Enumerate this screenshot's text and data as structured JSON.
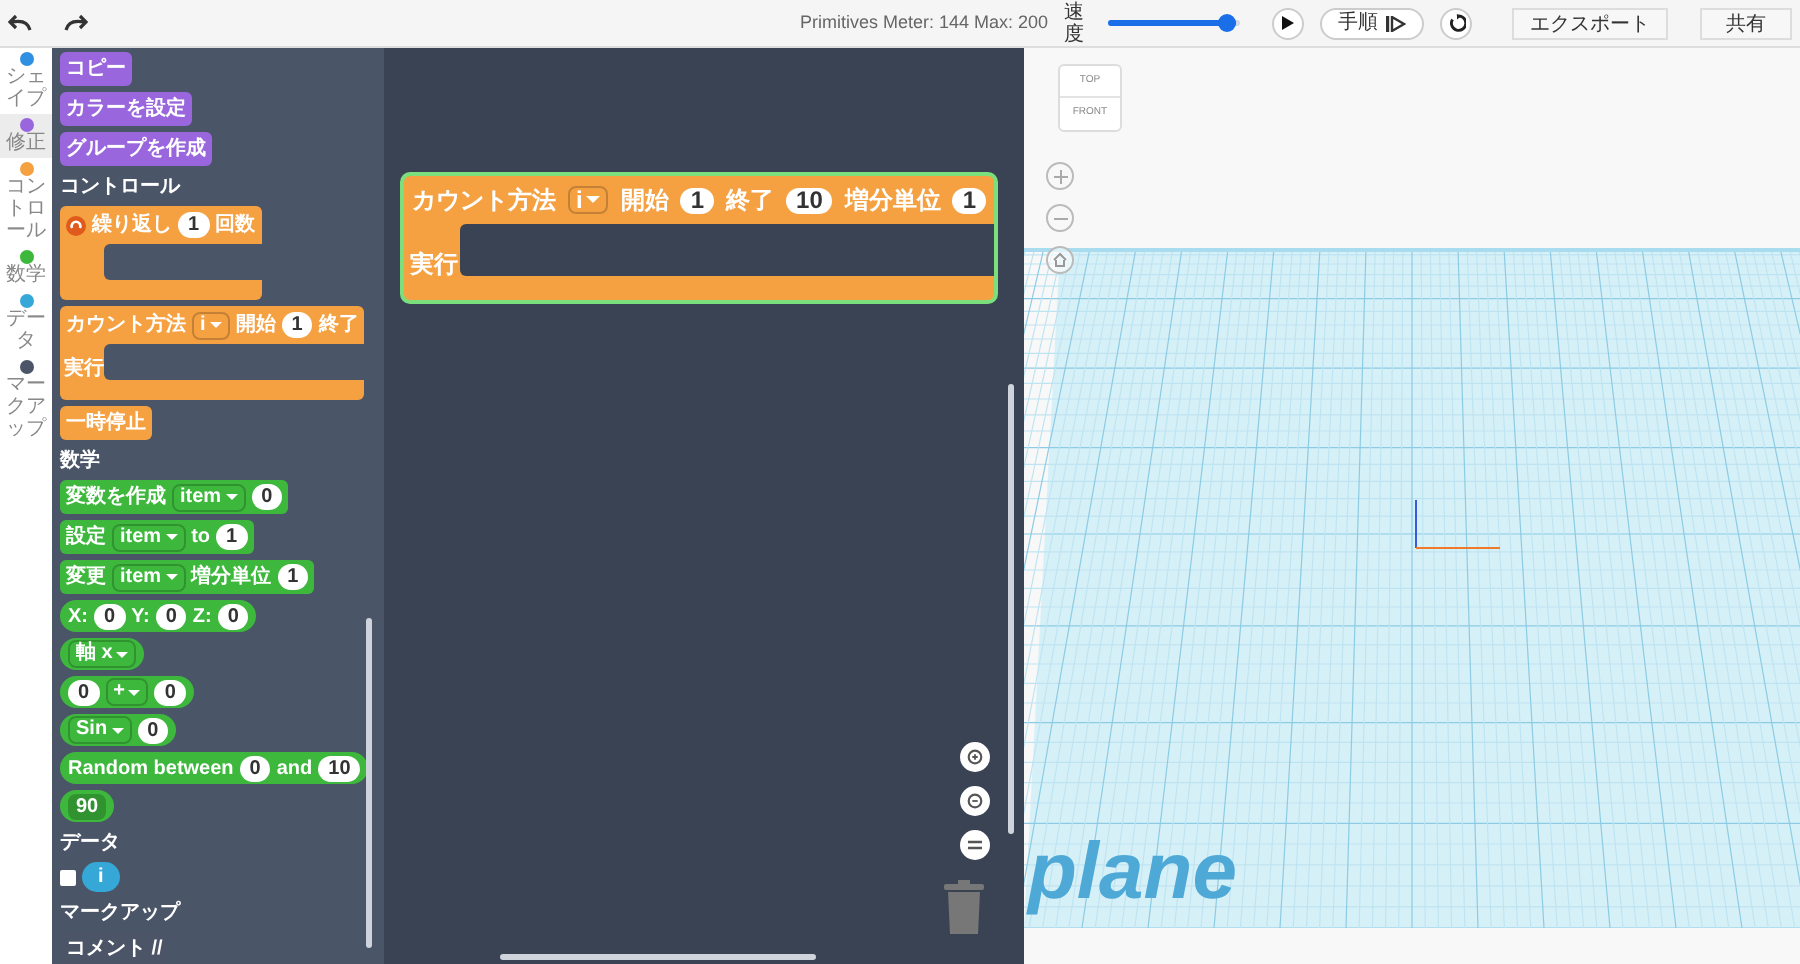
{
  "toolbar": {
    "meter": "Primitives Meter: 144 Max: 200",
    "speed_label": "速度",
    "speed": {
      "level": 0.97
    },
    "step_button": "手順",
    "export_button": "エクスポート",
    "share_button": "共有"
  },
  "categories": [
    {
      "label": "シェイプ",
      "color": "#2f8fe0",
      "selected": false
    },
    {
      "label": "修正",
      "color": "#9966dd",
      "selected": true
    },
    {
      "label": "コントロール",
      "color": "#f5a142",
      "selected": false
    },
    {
      "label": "数学",
      "color": "#3db83d",
      "selected": false
    },
    {
      "label": "データ",
      "color": "#35a8d8",
      "selected": false
    },
    {
      "label": "マークアップ",
      "color": "#4b5567",
      "selected": false
    }
  ],
  "flyout": [
    {
      "kind": "stack",
      "color": "#9966dd",
      "parts": [
        {
          "kind": "text",
          "text": "コピー"
        }
      ]
    },
    {
      "kind": "stack",
      "color": "#9966dd",
      "parts": [
        {
          "kind": "text",
          "text": "カラーを設定"
        }
      ]
    },
    {
      "kind": "stack",
      "color": "#9966dd",
      "parts": [
        {
          "kind": "text",
          "text": "グループを作成"
        }
      ]
    },
    {
      "kind": "heading",
      "text": "コントロール"
    },
    {
      "kind": "c_block",
      "color": "#f5a142",
      "has_icon": true,
      "parts": [
        {
          "kind": "text",
          "text": "繰り返し"
        },
        {
          "kind": "number",
          "text": "1"
        },
        {
          "kind": "text",
          "text": "回数"
        }
      ]
    },
    {
      "kind": "c_block",
      "color": "#f5a142",
      "has_icon": false,
      "inner_label": "実行",
      "parts": [
        {
          "kind": "text",
          "text": "カウント方法"
        },
        {
          "kind": "dropdown",
          "text": "i"
        },
        {
          "kind": "text",
          "text": "開始"
        },
        {
          "kind": "number",
          "text": "1"
        },
        {
          "kind": "text",
          "text": "終了"
        }
      ]
    },
    {
      "kind": "stack",
      "color": "#f5a142",
      "parts": [
        {
          "kind": "text",
          "text": "一時停止"
        }
      ]
    },
    {
      "kind": "heading",
      "text": "数学"
    },
    {
      "kind": "stack",
      "color": "#3db83d",
      "parts": [
        {
          "kind": "text",
          "text": "変数を作成"
        },
        {
          "kind": "dropdown",
          "text": "item"
        },
        {
          "kind": "number",
          "text": "0"
        }
      ]
    },
    {
      "kind": "stack",
      "color": "#3db83d",
      "parts": [
        {
          "kind": "text",
          "text": "設定"
        },
        {
          "kind": "dropdown",
          "text": "item"
        },
        {
          "kind": "text",
          "text": "to"
        },
        {
          "kind": "number",
          "text": "1"
        }
      ]
    },
    {
      "kind": "stack",
      "color": "#3db83d",
      "parts": [
        {
          "kind": "text",
          "text": "変更"
        },
        {
          "kind": "dropdown",
          "text": "item"
        },
        {
          "kind": "text",
          "text": "増分単位"
        },
        {
          "kind": "number",
          "text": "1"
        }
      ]
    },
    {
      "kind": "value",
      "color": "#3db83d",
      "parts": [
        {
          "kind": "text",
          "text": "X:"
        },
        {
          "kind": "number",
          "text": "0"
        },
        {
          "kind": "text",
          "text": "Y:"
        },
        {
          "kind": "number",
          "text": "0"
        },
        {
          "kind": "text",
          "text": "Z:"
        },
        {
          "kind": "number",
          "text": "0"
        }
      ]
    },
    {
      "kind": "value",
      "color": "#3db83d",
      "parts": [
        {
          "kind": "dropdown",
          "text": "軸 x"
        }
      ]
    },
    {
      "kind": "value",
      "color": "#3db83d",
      "parts": [
        {
          "kind": "number",
          "text": "0"
        },
        {
          "kind": "dropdown",
          "text": "+"
        },
        {
          "kind": "number",
          "text": "0"
        }
      ]
    },
    {
      "kind": "value",
      "color": "#3db83d",
      "parts": [
        {
          "kind": "dropdown",
          "text": "Sin"
        },
        {
          "kind": "number",
          "text": "0"
        }
      ]
    },
    {
      "kind": "value",
      "color": "#3db83d",
      "parts": [
        {
          "kind": "text",
          "text": "Random between"
        },
        {
          "kind": "number",
          "text": "0"
        },
        {
          "kind": "text",
          "text": "and"
        },
        {
          "kind": "number",
          "text": "10"
        }
      ]
    },
    {
      "kind": "value",
      "color": "#3db83d",
      "parts": [
        {
          "kind": "field",
          "text": "90"
        }
      ]
    },
    {
      "kind": "heading",
      "text": "データ"
    },
    {
      "kind": "variable",
      "checked": false,
      "label": "i",
      "color": "#35a8d8"
    },
    {
      "kind": "heading",
      "text": "マークアップ"
    },
    {
      "kind": "stack",
      "color": "#4b5567",
      "parts": [
        {
          "kind": "text",
          "text": "コメント //"
        }
      ]
    }
  ],
  "workspace_block": {
    "color": "#f5a142",
    "selected": true,
    "inner_label": "実行",
    "parts": [
      {
        "kind": "text",
        "text": "カウント方法"
      },
      {
        "kind": "dropdown",
        "text": "i"
      },
      {
        "kind": "text",
        "text": "開始"
      },
      {
        "kind": "number",
        "text": "1"
      },
      {
        "kind": "text",
        "text": "終了"
      },
      {
        "kind": "number",
        "text": "10"
      },
      {
        "kind": "text",
        "text": "増分単位"
      },
      {
        "kind": "number",
        "text": "1"
      }
    ]
  },
  "viewport": {
    "cube_top": "TOP",
    "cube_front": "FRONT",
    "plane_label": "plane"
  }
}
